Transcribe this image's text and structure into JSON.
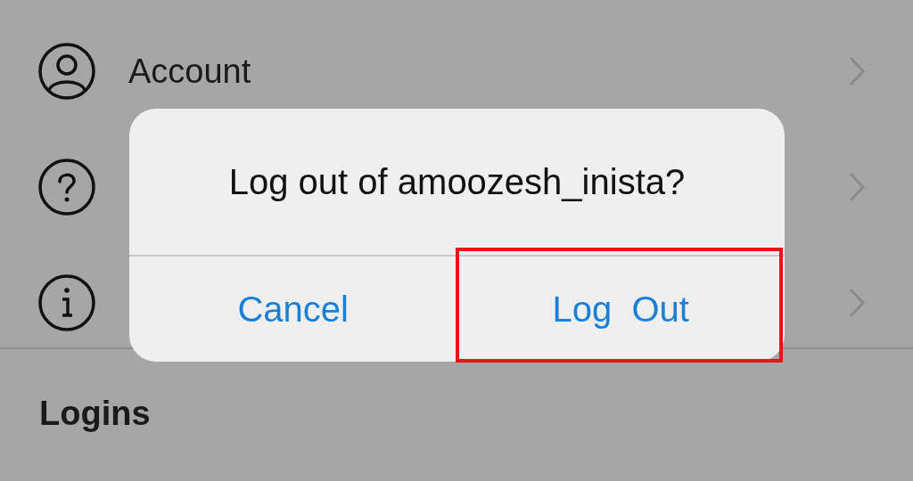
{
  "settings_rows": [
    {
      "kind": "person",
      "label": "Account"
    },
    {
      "kind": "help"
    },
    {
      "kind": "info"
    }
  ],
  "section_header": "Logins",
  "dialog": {
    "title": "Log out of amoozesh_inista?",
    "buttons": [
      {
        "label": "Cancel",
        "highlighted": false
      },
      {
        "label": "Log  Out",
        "highlighted": true
      }
    ]
  }
}
